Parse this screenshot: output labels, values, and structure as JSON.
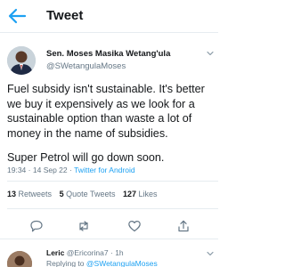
{
  "header": {
    "title": "Tweet"
  },
  "tweet": {
    "author_name": "Sen. Moses Masika Wetang'ula",
    "author_handle": "@SWetangulaMoses",
    "text_paragraph_1": "Fuel subsidy isn't sustainable. It's better we buy it expensively as we look for a sustainable option than waste a lot of money in the name of subsidies.",
    "text_paragraph_2": "Super Petrol will go down soon.",
    "time": "19:34",
    "date": "14 Sep 22",
    "separator": "·",
    "source": "Twitter for Android",
    "retweets_count": "13",
    "retweets_label": "Retweets",
    "quotes_count": "5",
    "quotes_label": "Quote Tweets",
    "likes_count": "127",
    "likes_label": "Likes"
  },
  "reply": {
    "name": "Leric",
    "handle": "@Ericorina7",
    "time": "1h",
    "replying_prefix": "Replying to",
    "replying_to": "@SWetangulaMoses"
  },
  "icons": {
    "back": "arrow-left-icon",
    "more": "chevron-down-icon",
    "reply": "comment-icon",
    "retweet": "retweet-icon",
    "like": "heart-icon",
    "share": "share-icon"
  },
  "colors": {
    "accent": "#1da1f2",
    "text_primary": "#14171a",
    "text_secondary": "#657786",
    "divider": "#e6ecf0"
  }
}
